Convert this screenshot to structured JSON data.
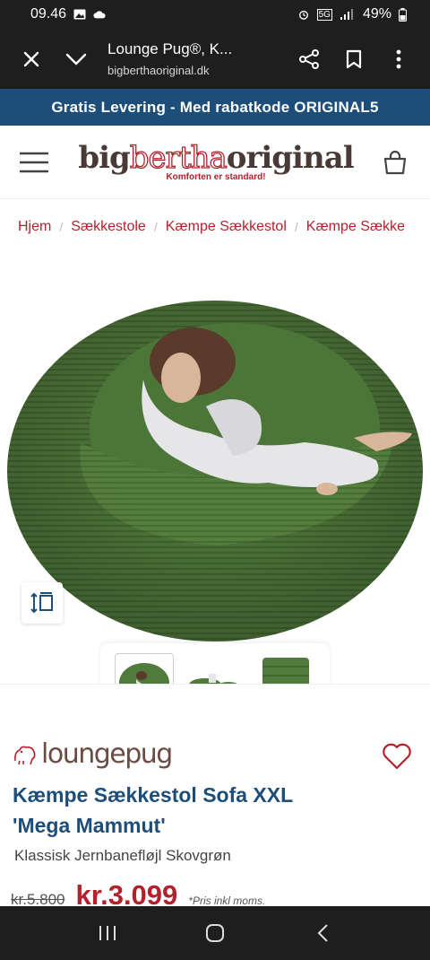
{
  "status": {
    "time": "09.46",
    "battery": "49%",
    "network": "5G"
  },
  "browser": {
    "title": "Lounge Pug®, K...",
    "host": "bigberthaoriginal.dk"
  },
  "promo": {
    "text": "Gratis Levering - Med rabatkode ORIGINAL5"
  },
  "header": {
    "logo_big": "big",
    "logo_bertha": "bertha",
    "logo_original": "original",
    "tagline": "Komforten er standard!"
  },
  "breadcrumb": [
    "Hjem",
    "Sækkestole",
    "Kæmpe Sækkestol",
    "Kæmpe Sække"
  ],
  "product": {
    "brand": "loungepug",
    "title_line1": "Kæmpe Sækkestol Sofa XXL",
    "title_line2": "'Mega Mammut'",
    "subtitle": "Klassisk Jernbanefløjl Skovgrøn",
    "old_price": "kr.5.800",
    "price": "kr.3.099",
    "vat_note": "*Pris inkl moms."
  },
  "colors": {
    "brand_blue": "#1d4e79",
    "accent_red": "#b4212d",
    "bag_green": "#4f7a3b"
  }
}
